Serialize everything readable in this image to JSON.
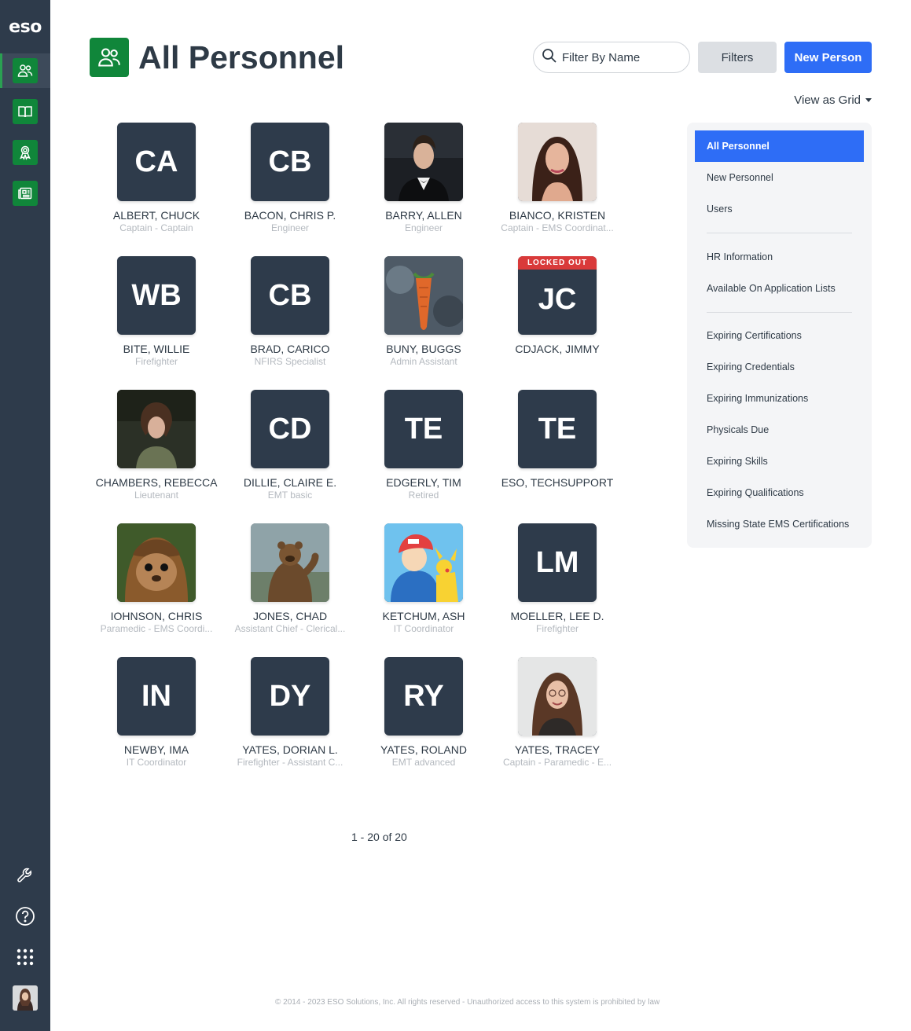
{
  "app": {
    "logo": "eso"
  },
  "header": {
    "title": "All Personnel",
    "search_placeholder": "Filter By Name",
    "filters_label": "Filters",
    "new_person_label": "New Person",
    "view_as_label": "View as Grid"
  },
  "personnel": [
    {
      "name": "ALBERT, CHUCK",
      "role": "Captain - Captain",
      "initials": "CA",
      "photo": null
    },
    {
      "name": "BACON, CHRIS P.",
      "role": "Engineer",
      "initials": "CB",
      "photo": null
    },
    {
      "name": "BARRY, ALLEN",
      "role": "Engineer",
      "initials": "",
      "photo": "man-tuxedo"
    },
    {
      "name": "BIANCO, KRISTEN",
      "role": "Captain - EMS Coordinat...",
      "initials": "",
      "photo": "woman-portrait"
    },
    {
      "name": "BITE, WILLIE",
      "role": "Firefighter",
      "initials": "WB",
      "photo": null
    },
    {
      "name": "BRAD, CARICO",
      "role": "NFIRS Specialist",
      "initials": "CB",
      "photo": null
    },
    {
      "name": "BUNY, BUGGS",
      "role": "Admin Assistant",
      "initials": "",
      "photo": "carrot"
    },
    {
      "name": "CDJACK, JIMMY",
      "role": "",
      "initials": "JC",
      "photo": null,
      "badge": "LOCKED OUT"
    },
    {
      "name": "CHAMBERS, REBECCA",
      "role": "Lieutenant",
      "initials": "",
      "photo": "game-character"
    },
    {
      "name": "DILLIE, CLAIRE E.",
      "role": "EMT basic",
      "initials": "CD",
      "photo": null
    },
    {
      "name": "EDGERLY, TIM",
      "role": "Retired",
      "initials": "TE",
      "photo": null
    },
    {
      "name": "ESO, TECHSUPPORT",
      "role": "",
      "initials": "TE",
      "photo": null
    },
    {
      "name": "IOHNSON, CHRIS",
      "role": "Paramedic - EMS Coordi...",
      "initials": "",
      "photo": "ewok"
    },
    {
      "name": "JONES, CHAD",
      "role": "Assistant Chief - Clerical...",
      "initials": "",
      "photo": "bear"
    },
    {
      "name": "KETCHUM, ASH",
      "role": "IT Coordinator",
      "initials": "",
      "photo": "cartoon"
    },
    {
      "name": "MOELLER, LEE D.",
      "role": "Firefighter",
      "initials": "LM",
      "photo": null
    },
    {
      "name": "NEWBY, IMA",
      "role": "IT Coordinator",
      "initials": "IN",
      "photo": null
    },
    {
      "name": "YATES, DORIAN L.",
      "role": "Firefighter - Assistant C...",
      "initials": "DY",
      "photo": null
    },
    {
      "name": "YATES, ROLAND",
      "role": "EMT advanced",
      "initials": "RY",
      "photo": null
    },
    {
      "name": "YATES, TRACEY",
      "role": "Captain - Paramedic - E...",
      "initials": "",
      "photo": "woman-glasses"
    }
  ],
  "pagination": {
    "label": "1 - 20 of 20"
  },
  "side_menu": {
    "group1": [
      "All Personnel",
      "New Personnel",
      "Users"
    ],
    "group2": [
      "HR Information",
      "Available On Application Lists"
    ],
    "group3": [
      "Expiring Certifications",
      "Expiring Credentials",
      "Expiring Immunizations",
      "Physicals Due",
      "Expiring Skills",
      "Expiring Qualifications",
      "Missing State EMS Certifications"
    ]
  },
  "footer": {
    "text": "© 2014 - 2023 ESO Solutions, Inc. All rights reserved - Unauthorized access to this system is prohibited by law"
  },
  "colors": {
    "accent_blue": "#2e6df6",
    "brand_green": "#10863a",
    "rail": "#2e3b4b",
    "locked_red": "#d93a3a"
  }
}
